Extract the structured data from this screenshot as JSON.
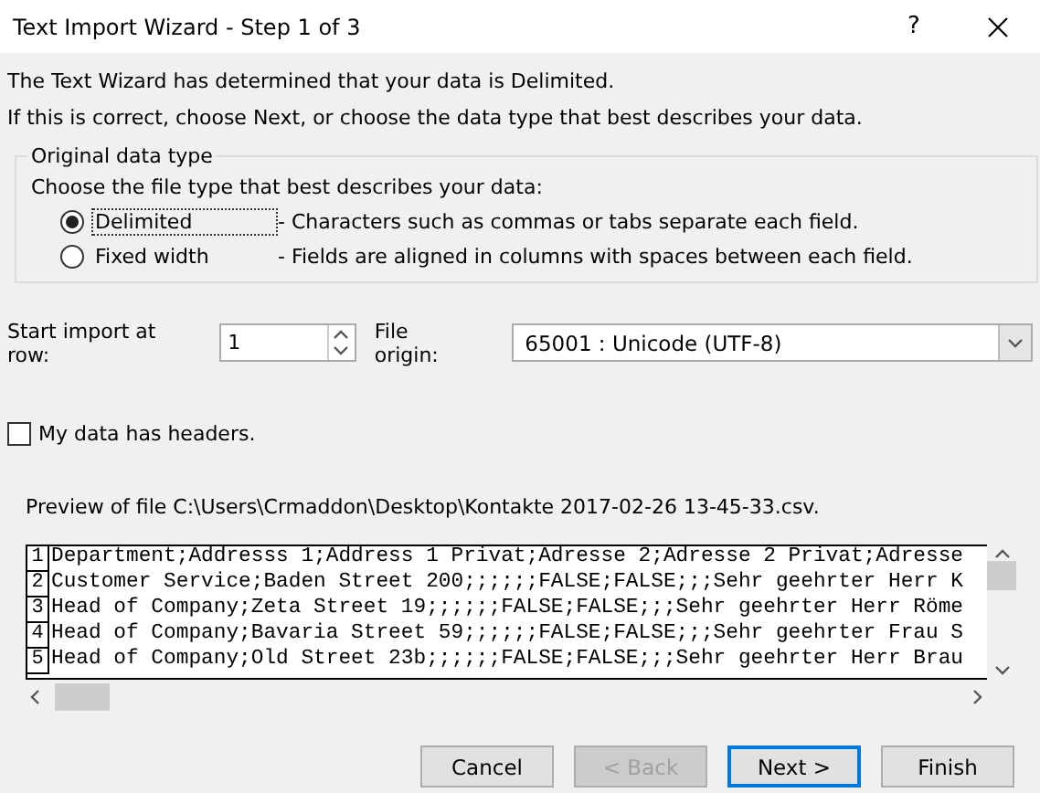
{
  "window": {
    "title": "Text Import Wizard - Step 1 of 3",
    "help": "?"
  },
  "intro": [
    "The Text Wizard has determined that your data is Delimited.",
    "If this is correct, choose Next, or choose the data type that best describes your data."
  ],
  "group": {
    "title": "Original data type",
    "prompt": "Choose the file type that best describes your data:",
    "options": [
      {
        "label": "Delimited",
        "description": "- Characters such as commas or tabs separate each field.",
        "selected": true
      },
      {
        "label": "Fixed width",
        "description": "- Fields are aligned in columns with spaces between each field.",
        "selected": false
      }
    ]
  },
  "start_row": {
    "label": "Start import at row:",
    "value": "1"
  },
  "file_origin": {
    "label": "File origin:",
    "value": "65001 : Unicode (UTF-8)"
  },
  "headers": {
    "label": "My data has headers.",
    "checked": false
  },
  "preview": {
    "label": "Preview of file C:\\Users\\Crmaddon\\Desktop\\Kontakte 2017-02-26 13-45-33.csv.",
    "rows": [
      {
        "number": "1",
        "text": "Department;Addresss 1;Address 1 Privat;Adresse 2;Adresse 2 Privat;Adresse"
      },
      {
        "number": "2",
        "text": "Customer Service;Baden Street 200;;;;;;FALSE;FALSE;;;Sehr geehrter Herr K"
      },
      {
        "number": "3",
        "text": "Head of Company;Zeta Street 19;;;;;;FALSE;FALSE;;;Sehr geehrter Herr Röme"
      },
      {
        "number": "4",
        "text": "Head of Company;Bavaria Street 59;;;;;;FALSE;FALSE;;;Sehr geehrter Frau S"
      },
      {
        "number": "5",
        "text": "Head of Company;Old Street 23b;;;;;;FALSE;FALSE;;;Sehr geehrter Herr Brau"
      }
    ]
  },
  "buttons": [
    {
      "label": "Cancel",
      "disabled": false,
      "default": false
    },
    {
      "label": "< Back",
      "disabled": true,
      "default": false
    },
    {
      "label": "Next >",
      "disabled": false,
      "default": true
    },
    {
      "label": "Finish",
      "disabled": false,
      "default": false
    }
  ]
}
